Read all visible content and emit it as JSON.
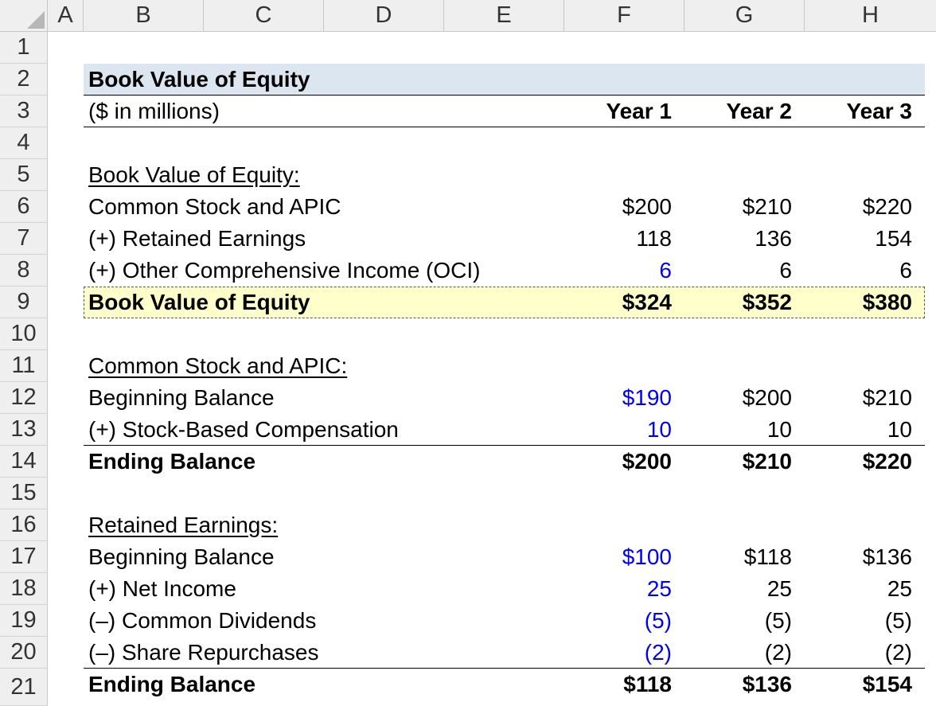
{
  "columns": [
    "A",
    "B",
    "C",
    "D",
    "E",
    "F",
    "G",
    "H"
  ],
  "rows": [
    "1",
    "2",
    "3",
    "4",
    "5",
    "6",
    "7",
    "8",
    "9",
    "10",
    "11",
    "12",
    "13",
    "14",
    "15",
    "16",
    "17",
    "18",
    "19",
    "20",
    "21"
  ],
  "title": "Book Value of Equity",
  "units": "($ in millions)",
  "years": [
    "Year 1",
    "Year 2",
    "Year 3"
  ],
  "bve": {
    "heading": "Book Value of Equity:",
    "common": {
      "label": "Common Stock and APIC",
      "values": [
        "$200",
        "$210",
        "$220"
      ]
    },
    "retained": {
      "label": "(+) Retained Earnings",
      "values": [
        "118",
        "136",
        "154"
      ]
    },
    "oci": {
      "label": "(+) Other Comprehensive Income (OCI)",
      "values": [
        "6",
        "6",
        "6"
      ]
    },
    "total": {
      "label": "Book Value of Equity",
      "values": [
        "$324",
        "$352",
        "$380"
      ]
    }
  },
  "apic": {
    "heading": "Common Stock and APIC:",
    "begin": {
      "label": "Beginning Balance",
      "values": [
        "$190",
        "$200",
        "$210"
      ]
    },
    "sbc": {
      "label": "(+) Stock-Based Compensation",
      "values": [
        "10",
        "10",
        "10"
      ]
    },
    "end": {
      "label": "Ending Balance",
      "values": [
        "$200",
        "$210",
        "$220"
      ]
    }
  },
  "re": {
    "heading": "Retained Earnings:",
    "begin": {
      "label": "Beginning Balance",
      "values": [
        "$100",
        "$118",
        "$136"
      ]
    },
    "ni": {
      "label": "(+) Net Income",
      "values": [
        "25",
        "25",
        "25"
      ]
    },
    "div": {
      "label": "(–) Common Dividends",
      "values": [
        "(5)",
        "(5)",
        "(5)"
      ]
    },
    "rep": {
      "label": "(–) Share Repurchases",
      "values": [
        "(2)",
        "(2)",
        "(2)"
      ]
    },
    "end": {
      "label": "Ending Balance",
      "values": [
        "$118",
        "$136",
        "$154"
      ]
    }
  },
  "colors": {
    "title_band": "#dce6f1",
    "highlight_band": "#ffffcc",
    "input_blue": "#0000ee"
  }
}
